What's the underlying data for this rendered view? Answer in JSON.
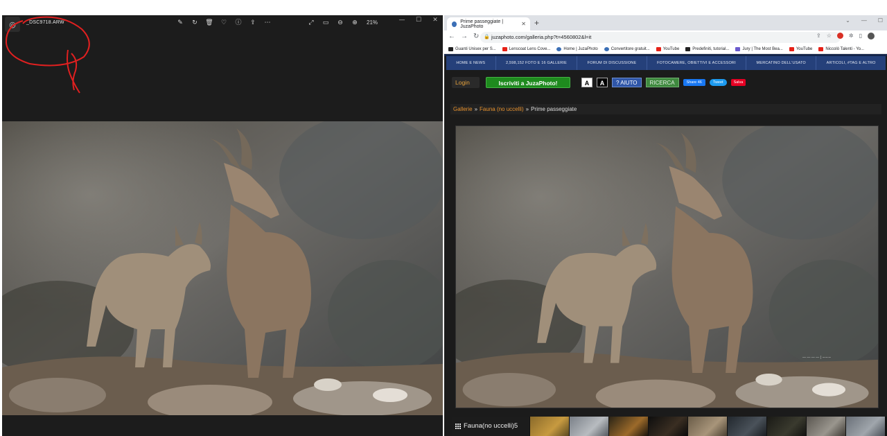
{
  "viewer": {
    "filename": "_DSC9718.ARW",
    "zoom": "21%",
    "toolbar_icons": [
      "edit-icon",
      "rotate-icon",
      "delete-icon",
      "favorite-icon",
      "info-icon",
      "share-icon",
      "more-icon"
    ],
    "toolbar_right_icons": [
      "fullscreen-icon",
      "fit-icon",
      "zoom-out-icon",
      "zoom-in-icon"
    ]
  },
  "browser": {
    "tab_title": "Prime passeggiate | JuzaPhoto",
    "url": "juzaphoto.com/galleria.php?t=4560802&l=it",
    "bookmarks": [
      {
        "label": "Guanti Unisex per S...",
        "icon": "amazon"
      },
      {
        "label": "Lenscoat Lens Cove...",
        "icon": "red"
      },
      {
        "label": "Home | JuzaPhoto",
        "icon": "juza"
      },
      {
        "label": "Convertitore gratuit...",
        "icon": "blue"
      },
      {
        "label": "YouTube",
        "icon": "youtube"
      },
      {
        "label": "Predefiniti, tutorial...",
        "icon": "dark"
      },
      {
        "label": "Jury | The Most Bea...",
        "icon": "purple"
      },
      {
        "label": "YouTube",
        "icon": "youtube"
      },
      {
        "label": "Niccolò Talenti - Yo...",
        "icon": "youtube"
      }
    ]
  },
  "site": {
    "menu": [
      "HOME E NEWS",
      "2,598,152 FOTO E 16 GALLERIE",
      "FORUM DI DISCUSSIONE",
      "FOTOCAMERE, OBIETTIVI E ACCESSORI",
      "MERCATINO DELL'USATO",
      "ARTICOLI, #TAG E ALTRO"
    ],
    "login": "Login",
    "signup": "Iscriviti a JuzaPhoto!",
    "font_a_light": "A",
    "font_a_dark": "A",
    "help": "? AIUTO",
    "search": "RICERCA",
    "share": "Share 46",
    "tweet": "Tweet",
    "save": "Salva",
    "breadcrumb": {
      "gallery": "Gallerie",
      "category": "Fauna (no uccelli)",
      "sep": "»",
      "current": "Prime passeggiate"
    },
    "thumbstrip_label": "Fauna(no uccelli)5"
  },
  "colors": {
    "menu_bg": "#25407a",
    "signup_bg": "#1e8b1e",
    "link": "#e8922e",
    "viewer_bg": "#1c1c1c"
  }
}
